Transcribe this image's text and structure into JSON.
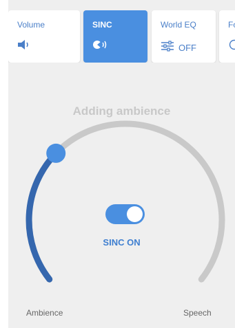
{
  "tabs": [
    {
      "label": "Volume",
      "icon": "speaker-icon",
      "active": false
    },
    {
      "label": "SINC",
      "icon": "sinc-icon",
      "active": true
    },
    {
      "label": "World EQ",
      "icon": "equalizer-icon",
      "state": "OFF",
      "active": false
    },
    {
      "label": "Fo",
      "icon": "partial-icon",
      "active": false
    }
  ],
  "dial": {
    "title": "Adding ambience",
    "level": 0.32,
    "min_label": "Ambience",
    "max_label": "Speech"
  },
  "sinc": {
    "on": true,
    "status": "SINC ON"
  },
  "colors": {
    "accent": "#4a8fe0",
    "arc_active": "#3567ae",
    "arc_track": "#c9c9c9",
    "background": "#efefef"
  }
}
